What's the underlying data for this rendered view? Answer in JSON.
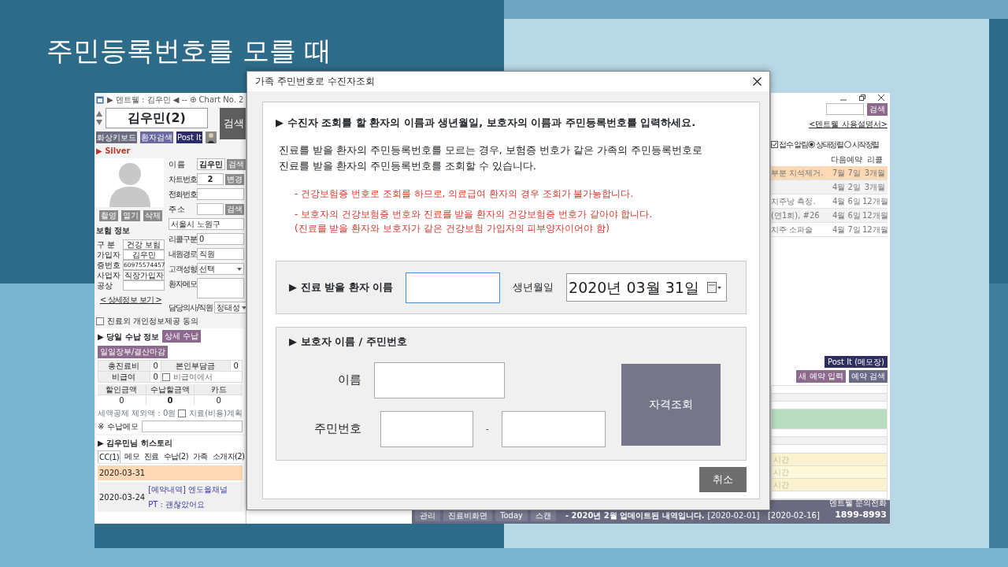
{
  "slide": {
    "title": "주민등록번호를 모를 때"
  },
  "back_window": {
    "left": {
      "header": "▶ 덴트웰 : 김우민 ◀ -- ⊕ Chart No. 2",
      "patient": "김우민(2)",
      "search_button": "검색",
      "tool_buttons": [
        "화상키보드",
        "환자검색",
        "Post It"
      ],
      "grade": "▶ Silver",
      "photo_buttons": [
        "촬영",
        "열기",
        "삭제"
      ],
      "insurance": {
        "title": "보험 정보",
        "rows": [
          {
            "label": "구 분",
            "value": "건강 보험"
          },
          {
            "label": "가입자",
            "value": "김우민"
          },
          {
            "label": "증번호",
            "value": "60975574457"
          },
          {
            "label": "사업자",
            "value": "직장가입자"
          },
          {
            "label": "공상"
          }
        ]
      },
      "detail_link": "< 상세정보 보기 >",
      "fields": [
        {
          "kind": "input",
          "label": "이 름",
          "value": "김우민",
          "button": "검색"
        },
        {
          "kind": "input",
          "label": "차트번호",
          "value": "2",
          "button": "변경"
        },
        {
          "kind": "input",
          "label": "전화번호"
        },
        {
          "kind": "input",
          "label": "주 소",
          "button": "검색"
        },
        {
          "kind": "input",
          "value": "서울시 노원구"
        },
        {
          "kind": "text",
          "label": "리콜구분",
          "value": "0"
        },
        {
          "kind": "text",
          "label": "내원경로",
          "value": "직원"
        },
        {
          "kind": "select",
          "label": "고객성향",
          "value": "선택"
        },
        {
          "kind": "memo",
          "label": "환자메모"
        },
        {
          "kind": "select",
          "label": "담당의사/직원",
          "value": "정태성"
        }
      ],
      "consent": {
        "label": "진료외 개인정보제공 동의",
        "checked": false
      },
      "payment": {
        "title": "▶ 당일 수납 정보",
        "buttons": [
          "상세 수납",
          "일일장부/결산마감"
        ],
        "summary_rows": [
          [
            "총진료비",
            "0",
            "본인부담금",
            "0"
          ],
          [
            "비급여",
            "0"
          ]
        ],
        "nonpay_check": {
          "label": "비급여에서",
          "checked": false
        },
        "amounts": {
          "columns": [
            "할인금액",
            "수납할금액",
            "카드"
          ],
          "values": [
            "0",
            "0",
            "0"
          ]
        },
        "tax": "세액공제 제외액 : 0원",
        "plan_check": {
          "label": "치료(비용)계획",
          "checked": false
        },
        "memo_label": "※ 수납메모"
      },
      "history": {
        "title": "▶ 김우민님 히스토리",
        "tabs": [
          {
            "label": "CC(1)",
            "selected": true
          },
          {
            "label": "메모",
            "selected": false
          },
          {
            "label": "진료",
            "selected": false
          },
          {
            "label": "수납(2)",
            "selected": false
          },
          {
            "label": "가족",
            "selected": false
          },
          {
            "label": "소개자(2)",
            "selected": false
          }
        ],
        "entries": [
          {
            "date": "2020-03-31",
            "highlighted": true
          },
          {
            "date": "2020-03-24",
            "highlighted": false,
            "lines": [
              "[예약내역] 엔도올채널",
              "PT : 괜찮았어요"
            ]
          }
        ]
      }
    },
    "right": {
      "search_button": "검색",
      "manual_link": "<덴트웰 사용설명서>",
      "options": [
        {
          "kind": "checkbox",
          "label": "접수 알림",
          "checked": true
        },
        {
          "kind": "radio",
          "label": "상태정렬",
          "selected": true
        },
        {
          "kind": "radio",
          "label": "시작정렬",
          "selected": false
        }
      ],
      "table": {
        "columns": [
          "다음예약",
          "리콜"
        ],
        "rows": [
          {
            "treatment": "부분 치석제거.",
            "next": "7월 7일",
            "recall": "3개월",
            "highlighted": true
          },
          {
            "next": "4월 2일",
            "recall": "3개월",
            "highlighted": false
          },
          {
            "treatment": "치주낭 측정.",
            "next": "4월 6일",
            "recall": "12개월",
            "highlighted": false
          },
          {
            "treatment": "(연1회), #26",
            "next": "4월 6일",
            "recall": "12개월",
            "highlighted": false
          },
          {
            "treatment": "치주 소파술",
            "next": "4월 7일",
            "recall": "12개월",
            "highlighted": false
          }
        ]
      },
      "memo_button": "Post It (메모장)",
      "buttons": [
        "새 예약 입력",
        "예약 검색"
      ],
      "schedule": [
        {
          "color": "#ffffff"
        },
        {
          "color": "#f2f2f2"
        },
        {
          "color": "#ffffff"
        },
        {
          "color": "#b7dcbf"
        },
        {
          "color": "#ffffff"
        },
        {
          "color": "#f2f2f2"
        },
        {
          "color": "#ffffff"
        },
        {
          "color": "#fbf3cf",
          "text": "시간"
        },
        {
          "color": "#fdf8d8",
          "text": "시간"
        },
        {
          "color": "#fbf3cf",
          "text": "시간"
        },
        {
          "color": "#ffffff"
        }
      ]
    },
    "bottom_bar": {
      "buttons": [
        "관리",
        "진료비화면",
        "Today",
        "스캔"
      ],
      "notice": "- 2020년 2월 업데이트된 내역입니다.",
      "notice_date": "[2020-02-01]",
      "right_date": "[2020-02-16]",
      "contact_label": "덴트웰 문의전화",
      "contact_phone": "1899-8993"
    }
  },
  "dialog": {
    "title": "가족 주민번호로 수진자조회",
    "heading": "▶ 수진자 조회를 할 환자의 이름과 생년월일, 보호자의 이름과 주민등록번호를 입력하세요.",
    "intro": "진료를 받을 환자의 주민등록번호를 모르는 경우, 보험증 번호가 같은 가족의 주민등록번호로\n진료를 받을 환자의 주민등록번호를 조회할 수 있습니다.",
    "notes": [
      "- 건강보험증 번호로 조회를 하므로, 의료급여 환자의 경우 조회가 불가능합니다.",
      "- 보호자의 건강보험증 번호와 진료를 받을 환자의 건강보험증 번호가 같아야 합니다.\n (진료를 받을 환자와 보호자가 같은 건강보험 가입자의 피부양자이어야 함)"
    ],
    "patient_section": {
      "label": "▶ 진료 받을 환자 이름",
      "name_field": {
        "focused": true
      },
      "birth_label": "생년월일",
      "birth_date": "2020년 03월 31일"
    },
    "guardian_section": {
      "title": "▶ 보호자 이름 / 주민번호",
      "name_label": "이름",
      "id_label": "주민번호",
      "separator": "-",
      "check_button": "자격조회"
    },
    "cancel_button": "취소"
  }
}
